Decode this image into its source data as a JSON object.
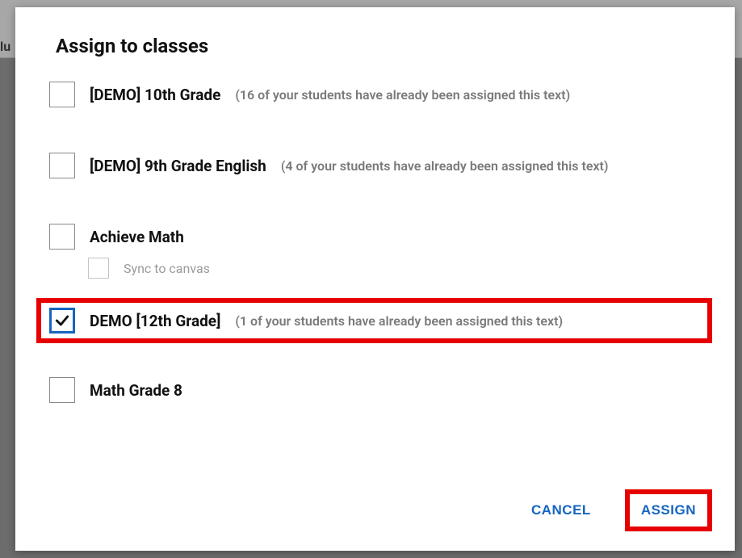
{
  "dialog": {
    "title": "Assign to classes"
  },
  "classes": [
    {
      "name": "[DEMO] 10th Grade",
      "note": "(16 of your students have already been assigned this text)",
      "checked": false
    },
    {
      "name": "[DEMO] 9th Grade English",
      "note": "(4 of your students have already been assigned this text)",
      "checked": false
    },
    {
      "name": "Achieve Math",
      "note": "",
      "checked": false,
      "sync_label": "Sync to canvas",
      "sync_checked": false
    },
    {
      "name": "DEMO [12th Grade]",
      "note": "(1 of your students have already been assigned this text)",
      "checked": true,
      "highlight": true
    },
    {
      "name": "Math Grade 8",
      "note": "",
      "checked": false
    }
  ],
  "actions": {
    "cancel": "CANCEL",
    "assign": "ASSIGN"
  },
  "background": {
    "fragment": "lu"
  }
}
